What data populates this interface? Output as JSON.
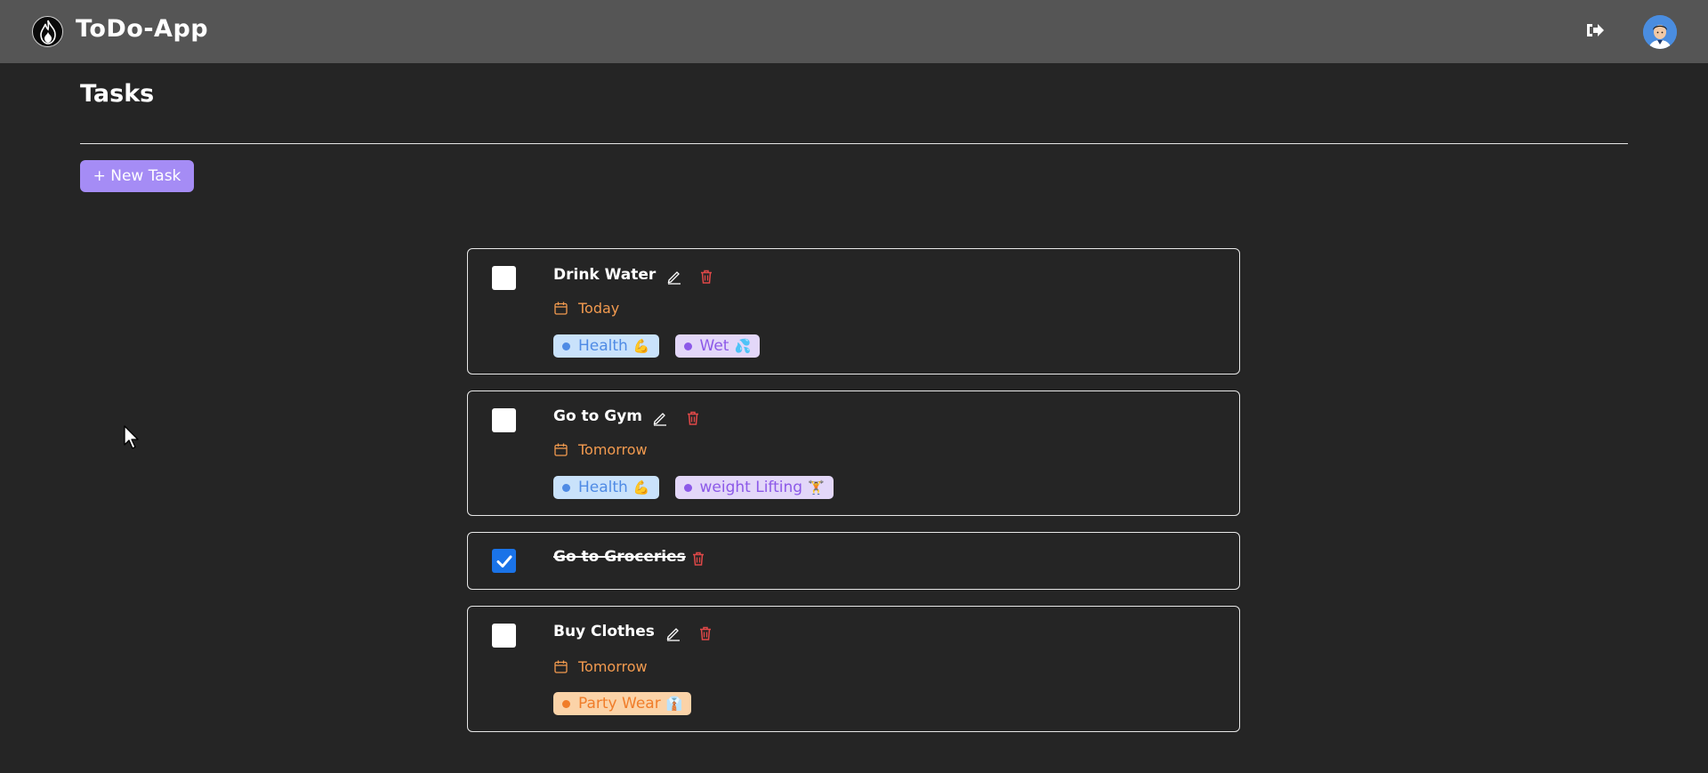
{
  "app": {
    "title": "ToDo-App",
    "logo_icon": "flame-icon",
    "logout_icon": "sign-out-icon",
    "avatar_icon": "user-avatar"
  },
  "page": {
    "title": "Tasks",
    "new_task_label": "+ New Task"
  },
  "colors": {
    "navbar": "#555555",
    "background": "#252525",
    "accent": "#a58cf5",
    "due_text": "#f29a4f",
    "delete_icon": "#e04848",
    "checked": "#1a73e8"
  },
  "tasks": [
    {
      "title": "Drink Water",
      "completed": false,
      "due": "Today",
      "tags": [
        {
          "label": "Health",
          "emoji": "💪",
          "color": "blue"
        },
        {
          "label": "Wet",
          "emoji": "💦",
          "color": "purple"
        }
      ]
    },
    {
      "title": "Go to Gym",
      "completed": false,
      "due": "Tomorrow",
      "tags": [
        {
          "label": "Health",
          "emoji": "💪",
          "color": "blue"
        },
        {
          "label": "weight Lifting",
          "emoji": "🏋",
          "color": "purple"
        }
      ]
    },
    {
      "title": "Go to Groceries",
      "completed": true
    },
    {
      "title": "Buy Clothes",
      "completed": false,
      "due": "Tomorrow",
      "tags": [
        {
          "label": "Party Wear",
          "emoji": "👔",
          "color": "orange"
        }
      ]
    }
  ]
}
